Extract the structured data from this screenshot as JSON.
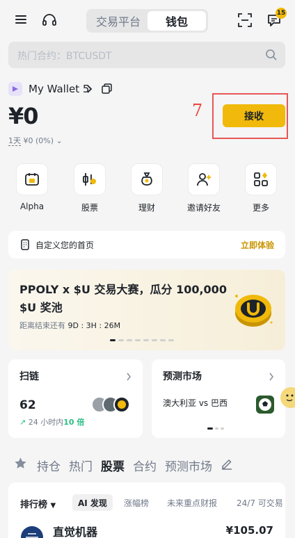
{
  "header": {
    "tabs": [
      "交易平台",
      "钱包"
    ],
    "active_tab": "钱包",
    "message_badge": "15"
  },
  "search": {
    "placeholder": "热门合约：BTCUSDT"
  },
  "wallet": {
    "name": "My Wallet 5",
    "balance": "¥0",
    "period": "1天",
    "change": "¥0 (0%)",
    "receive_label": "接收",
    "annotation_number": "7"
  },
  "quick_actions": [
    {
      "label": "Alpha",
      "icon": "alpha-calendar-icon"
    },
    {
      "label": "股票",
      "icon": "stock-chart-icon"
    },
    {
      "label": "理财",
      "icon": "money-bag-icon"
    },
    {
      "label": "邀请好友",
      "icon": "invite-user-icon"
    },
    {
      "label": "更多",
      "icon": "more-grid-icon"
    }
  ],
  "customize": {
    "label": "自定义您的首页",
    "link": "立即体验"
  },
  "promo": {
    "title": "PPOLY x $U 交易大赛，瓜分 100,000 $U 奖池",
    "countdown_prefix": "距离结束还有",
    "countdown": "9D : 3H : 26M"
  },
  "cards": {
    "chain": {
      "title": "扫链",
      "value": "62",
      "sub_prefix": "24 小时内",
      "sub_value": "10 倍"
    },
    "prediction": {
      "title": "预测市场",
      "match": "澳大利亚 vs 巴西"
    }
  },
  "content_tabs": [
    "持仓",
    "热门",
    "股票",
    "合约",
    "预测市场"
  ],
  "active_content_tab": "股票",
  "ranking": {
    "title": "排行榜",
    "chips": [
      "AI 发现",
      "涨幅榜",
      "未来重点财报",
      "24/7 可交易"
    ],
    "active_chip": "AI 发现",
    "first_stock": {
      "name": "直觉机器",
      "price": "¥105.07"
    }
  },
  "colors": {
    "accent": "#f0b90b",
    "up": "#2ebd85",
    "annotation": "#e8453c"
  }
}
